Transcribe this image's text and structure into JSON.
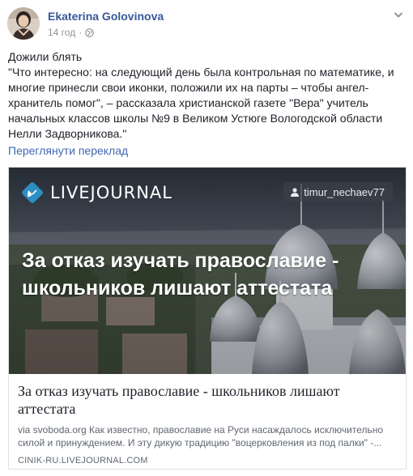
{
  "author": {
    "name": "Ekaterina Golovinova",
    "time": "14 год",
    "separator": "·",
    "audience_icon": "globe-icon"
  },
  "menu_icon": "chevron-down-icon",
  "post": {
    "lines": [
      "Дожили блять",
      "\"Что интересно: на следующий день была контрольная по математике, и",
      "многие принесли свои иконки, положили их на парты – чтобы ангел-",
      "хранитель помог\", – рассказала христианской газете \"Вера\" учитель",
      "начальных классов школы №9 в Великом Устюге Вологодской области",
      "Нелли Задворникова.\""
    ],
    "translate_label": "Переглянути переклад"
  },
  "card": {
    "logo_text": "LIVEJOURNAL",
    "user_badge": "timur_nechaev77",
    "headline_lines": [
      "За отказ изучать православие -",
      "школьников лишают аттестата"
    ],
    "title_lines": [
      "За отказ изучать православие - школьников лишают",
      "аттестата"
    ],
    "description_lines": [
      "via svoboda.org Как известно, православие на Руси насаждалось исключительно",
      "силой и принуждением. И эту дикую традицию \"воцерковления из под палки\" -..."
    ],
    "domain": "CINIK-RU.LIVEJOURNAL.COM"
  },
  "colors": {
    "link": "#365899",
    "translate": "#4267b2",
    "meta": "#90949c",
    "text": "#1d2129",
    "card_border": "#dddfe2",
    "lj_blue": "#2b8fc3"
  }
}
